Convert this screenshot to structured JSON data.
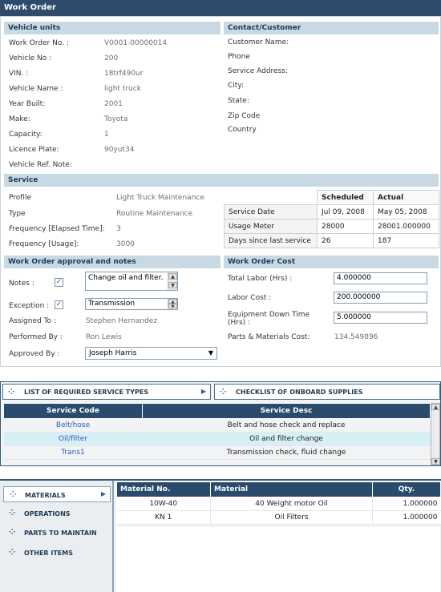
{
  "window": {
    "title": "Work Order"
  },
  "vehicle": {
    "header": "Vehicle units",
    "fields": [
      {
        "label": "Work Order No. :",
        "value": "V0001-00000014"
      },
      {
        "label": "Vehicle No :",
        "value": "200"
      },
      {
        "label": "VIN. :",
        "value": "18trf490ur"
      },
      {
        "label": "Vehicle Name :",
        "value": "light truck"
      },
      {
        "label": "Year Built:",
        "value": "2001"
      },
      {
        "label": "Make:",
        "value": "Toyota"
      },
      {
        "label": "Capacity:",
        "value": "1"
      },
      {
        "label": "Licence Plate:",
        "value": "90yut34"
      },
      {
        "label": "Vehicle Ref. Note:",
        "value": ""
      }
    ]
  },
  "contact": {
    "header": "Contact/Customer",
    "fields": [
      "Customer Name:",
      "Phone",
      "Service Address:",
      "City:",
      "State:",
      "Zip Code",
      "Country"
    ]
  },
  "service": {
    "header": "Service",
    "fields": [
      {
        "label": "Profile",
        "value": "Light Truck Maintenance"
      },
      {
        "label": "Type",
        "value": "Routine Maintenance"
      },
      {
        "label": "Frequency [Elapsed Time]:",
        "value": "3"
      },
      {
        "label": "Frequency [Usage]:",
        "value": "3000"
      }
    ],
    "schedule": {
      "col_scheduled": "Scheduled",
      "col_actual": "Actual",
      "rows": [
        {
          "label": "Service Date",
          "scheduled": "Jul 09, 2008",
          "actual": "May 05, 2008"
        },
        {
          "label": "Usage Meter",
          "scheduled": "28000",
          "actual": "28001.000000"
        },
        {
          "label": "Days since last service",
          "scheduled": "26",
          "actual": "187"
        }
      ]
    }
  },
  "approval": {
    "header": "Work Order approval and notes",
    "notes_label": "Notes :",
    "notes_value": "Change oil and filter.",
    "exception_label": "Exception :",
    "exception_value": "Transmission",
    "assigned_label": "Assigned To :",
    "assigned_value": "Stephen Hernandez",
    "performed_label": "Performed By :",
    "performed_value": "Ron Lewis",
    "approved_label": "Approved By :",
    "approved_value": "Joseph Harris"
  },
  "cost": {
    "header": "Work Order Cost",
    "labor_hrs_label": "Total Labor (Hrs) :",
    "labor_hrs_value": "4.000000",
    "labor_cost_label": "Labor Cost :",
    "labor_cost_value": "200.000000",
    "downtime_label_1": "Equipment Down Time",
    "downtime_label_2": "(Hrs) :",
    "downtime_value": "5.000000",
    "parts_label": "Parts & Materials Cost:",
    "parts_value": "134.549896"
  },
  "service_tabs": {
    "tab1": "LIST OF REQUIRED SERVICE TYPES",
    "tab2": "CHECKLIST OF ONBOARD SUPPLIES",
    "columns": [
      "Service Code",
      "Service Desc"
    ],
    "rows": [
      {
        "code": "Belt/hose",
        "desc": "Belt and hose check and replace"
      },
      {
        "code": "Oil/filter",
        "desc": "Oil and filter change"
      },
      {
        "code": "Trans1",
        "desc": "Transmission check, fluid change"
      }
    ]
  },
  "side_nav": {
    "items": [
      "MATERIALS",
      "OPERATIONS",
      "PARTS TO MAINTAIN",
      "OTHER ITEMS"
    ]
  },
  "materials": {
    "columns": [
      "Material No.",
      "Material",
      "Qty."
    ],
    "rows": [
      {
        "no": "10W-40",
        "material": "40 Weight motor Oil",
        "qty": "1.000000"
      },
      {
        "no": "KN 1",
        "material": "Oil Filters",
        "qty": "1.000000"
      }
    ]
  },
  "colors": {
    "header_bg": "#2e4b6b",
    "section_bg": "#c8d9e4",
    "grid_header": "#2b4b6c",
    "selected_row": "#d7f0f7"
  }
}
